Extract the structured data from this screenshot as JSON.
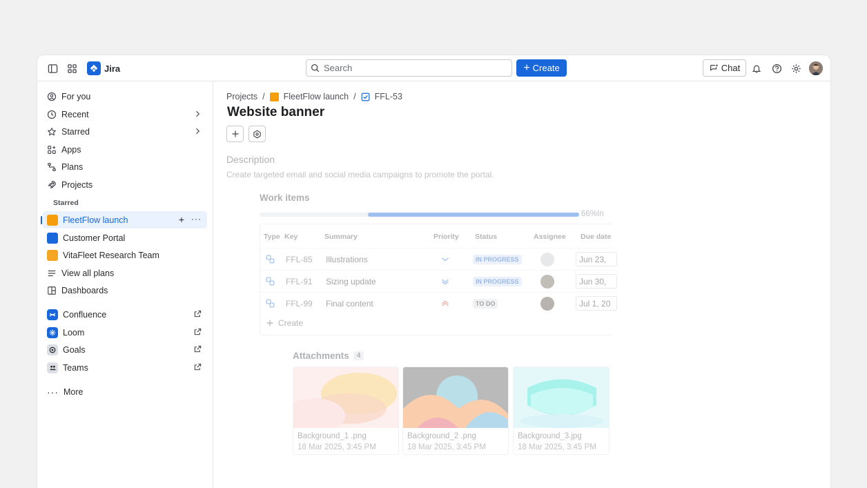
{
  "app": {
    "name": "Jira"
  },
  "topbar": {
    "search_placeholder": "Search",
    "create_label": "Create",
    "chat_label": "Chat"
  },
  "sidebar": {
    "items": [
      {
        "label": "For you"
      },
      {
        "label": "Recent"
      },
      {
        "label": "Starred"
      },
      {
        "label": "Apps"
      },
      {
        "label": "Plans"
      },
      {
        "label": "Projects"
      }
    ],
    "starred_label": "Starred",
    "projects": [
      {
        "label": "FleetFlow launch",
        "color": "#f59e0b"
      },
      {
        "label": "Customer Portal",
        "color": "#1868db"
      },
      {
        "label": "VitaFleet Research Team",
        "color": "#f5a623"
      }
    ],
    "view_all_plans": "View all plans",
    "dashboards": "Dashboards",
    "apps": [
      {
        "label": "Confluence",
        "color": "#1868db"
      },
      {
        "label": "Loom",
        "color": "#1868db"
      },
      {
        "label": "Goals",
        "color": "#dcdfe4"
      },
      {
        "label": "Teams",
        "color": "#dcdfe4"
      }
    ],
    "more_label": "More"
  },
  "breadcrumb": {
    "projects": "Projects",
    "project": "FleetFlow launch",
    "issue": "FFL-53"
  },
  "page": {
    "title": "Website banner"
  },
  "description": {
    "heading": "Description",
    "text": "Create targeted email and social media campaigns to promote the portal."
  },
  "work_items": {
    "heading": "Work items",
    "progress": 0.66,
    "progress_label": "66%In",
    "columns": [
      "Type",
      "Key",
      "Summary",
      "Priority",
      "Status",
      "Assignee",
      "Due date"
    ],
    "rows": [
      {
        "key": "FFL-85",
        "summary": "Illustrations",
        "priority_icon": "priority-medium-icon",
        "status": "IN PROGRESS",
        "due": "Jun 23,"
      },
      {
        "key": "FFL-91",
        "summary": "Sizing update",
        "priority_icon": "priority-lowest-icon",
        "status": "IN PROGRESS",
        "due": "Jun 30,"
      },
      {
        "key": "FFL-99",
        "summary": "Final content",
        "priority_icon": "priority-highest-icon",
        "status": "TO DO",
        "due": "Jul 1, 20"
      }
    ],
    "create_label": "Create"
  },
  "attachments": {
    "heading": "Attachments",
    "count": "4",
    "items": [
      {
        "name": "Background_1 .png",
        "date": "18 Mar 2025, 3:45 PM"
      },
      {
        "name": "Background_2 .png",
        "date": "18 Mar 2025, 3:45 PM"
      },
      {
        "name": "Background_3.jpg",
        "date": "18 Mar 2025, 3:45 PM"
      }
    ]
  },
  "colors": {
    "brand": "#1868db",
    "selected_bg": "#e9f2fe"
  }
}
